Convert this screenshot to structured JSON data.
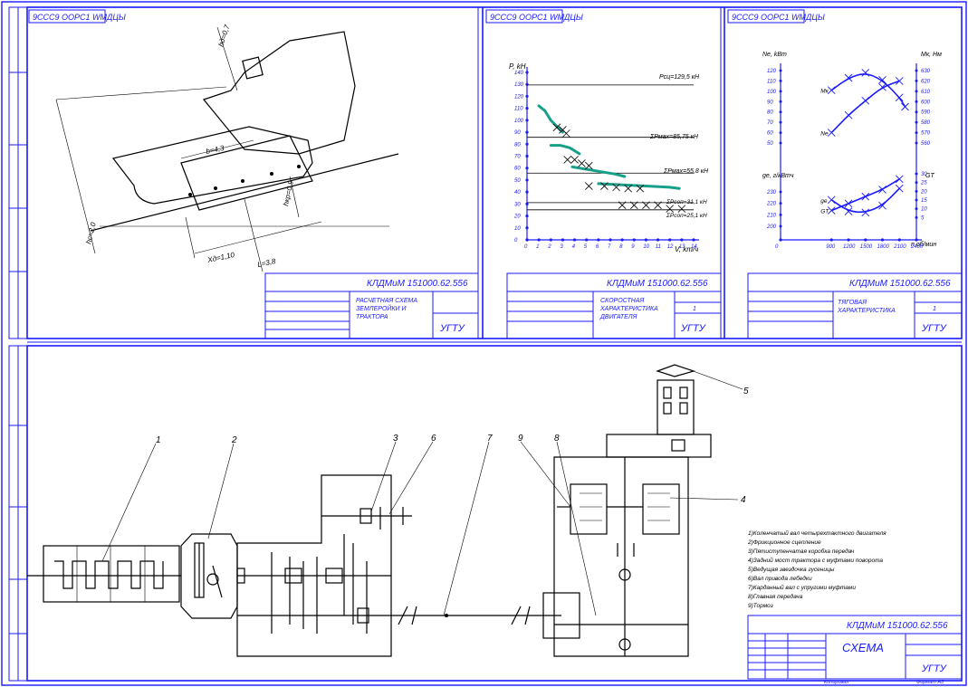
{
  "colors": {
    "frame": "#1a1aff",
    "ink": "#000000",
    "curve": "#16a08a",
    "paper": "#ffffff"
  },
  "stamp_code": "9ССС9 ООРС1 WМДЦЫ",
  "sheets": {
    "top_left": {
      "doc_code": "КЛДМиМ 151000.62.556",
      "title_l1": "РАСЧЕТНАЯ СХЕМА",
      "title_l2": "ЗЕМЛЕРОЙКИ И",
      "title_l3": "ТРАКТОРА",
      "org": "УГТУ",
      "labels": {
        "hc": "hc=2,0",
        "b": "b=4,3",
        "hkp": "hкр=0,9",
        "hd": "hд=0,7",
        "xd": "Xд=1,10",
        "l": "L=3,8"
      }
    },
    "top_mid": {
      "doc_code": "КЛДМиМ 151000.62.556",
      "title_l1": "СКОРОСТНАЯ",
      "title_l2": "ХАРАКТЕРИСТИКА",
      "title_l3": "ДВИГАТЕЛЯ",
      "org": "УГТУ",
      "sheet_no": "1",
      "y_axis_label": "P, kH",
      "x_axis_label": "V, km/ч",
      "lines": [
        "Pсц=129,5 кН",
        "ΣPмах=85,75 кН",
        "ΣPмах=55,8 кН",
        "ΣPсоп=31,1 кН",
        "ΣPсоп=25,1 кН"
      ]
    },
    "top_right": {
      "doc_code": "КЛДМиМ 151000.62.556",
      "title_l1": "ТЯГОВАЯ",
      "title_l2": "ХАРАКТЕРИСТИКА",
      "org": "УГТУ",
      "sheet_no": "1",
      "left_axis_top": "Ne, kBm",
      "right_axis_top": "Mк, Нм",
      "left_axis_bottom": "ge, г/кВтч",
      "right_axis_bottom": "GT",
      "x_axis_label": "n об/мин",
      "curve_tags": [
        "Mк",
        "Ne",
        "ge",
        "GT"
      ]
    },
    "bottom": {
      "doc_code": "КЛДМиМ 151000.62.556",
      "title": "СХЕМА",
      "org": "УГТУ",
      "footer_left": "Копировал",
      "footer_right": "Формат А3",
      "numbers": [
        "1",
        "2",
        "3",
        "4",
        "5",
        "6",
        "7",
        "8",
        "9"
      ],
      "legend": [
        "1)Коленчатый вал четырехтактного двигателя",
        "2)Фрикционное сцепление",
        "3)Пятиступенчатая коробка передач",
        "4)Задний мост трактора с муфтами поворота",
        "5)Ведущая звездочка гусеницы",
        "6)Вал привода лебедки",
        "7)Карданный вал с упругими муфтами",
        "8)Главная передача",
        "9)Тормоз"
      ]
    }
  },
  "chart_data": [
    {
      "type": "line",
      "title": "СКОРОСТНАЯ ХАРАКТЕРИСТИКА ДВИГАТЕЛЯ",
      "xlabel": "V, km/ч",
      "ylabel": "P, kH",
      "x_ticks": [
        0,
        1,
        2,
        3,
        4,
        5,
        6,
        7,
        8,
        9,
        10,
        11,
        12,
        13,
        14
      ],
      "y_ticks": [
        0,
        10,
        20,
        30,
        40,
        50,
        60,
        70,
        80,
        90,
        100,
        110,
        120,
        130,
        140
      ],
      "xlim": [
        0,
        14
      ],
      "ylim": [
        0,
        140
      ],
      "hlines": [
        129.5,
        85.75,
        55.8,
        31.1,
        25.1
      ],
      "series": [
        {
          "x": [
            1.0,
            1.5,
            2.0,
            2.5,
            3.0
          ],
          "y": [
            112,
            108,
            100,
            95,
            90
          ]
        },
        {
          "x": [
            2.0,
            2.8,
            3.6,
            4.4
          ],
          "y": [
            79,
            79,
            77,
            72
          ]
        },
        {
          "x": [
            3.8,
            5.0,
            6.2,
            7.4,
            8.2
          ],
          "y": [
            61,
            59,
            57,
            55,
            53
          ]
        },
        {
          "x": [
            6.0,
            8.0,
            10.0,
            12.0,
            12.8
          ],
          "y": [
            47,
            46,
            45,
            44,
            43
          ]
        }
      ],
      "markers": [
        {
          "x": 2.5,
          "y": 94
        },
        {
          "x": 3.0,
          "y": 92
        },
        {
          "x": 3.3,
          "y": 89
        },
        {
          "x": 3.4,
          "y": 67
        },
        {
          "x": 4.0,
          "y": 67
        },
        {
          "x": 4.6,
          "y": 64
        },
        {
          "x": 5.2,
          "y": 62
        },
        {
          "x": 5.2,
          "y": 45
        },
        {
          "x": 6.5,
          "y": 45
        },
        {
          "x": 7.5,
          "y": 44
        },
        {
          "x": 8.5,
          "y": 43
        },
        {
          "x": 9.5,
          "y": 43
        },
        {
          "x": 8.0,
          "y": 29
        },
        {
          "x": 9.0,
          "y": 29
        },
        {
          "x": 10.0,
          "y": 29
        },
        {
          "x": 11.0,
          "y": 29
        },
        {
          "x": 12.0,
          "y": 26
        },
        {
          "x": 13.0,
          "y": 26
        }
      ]
    },
    {
      "type": "line",
      "title": "ТЯГОВАЯ ХАРАКТЕРИСТИКА",
      "xlabel": "n об/мин",
      "x_ticks": [
        0,
        900,
        1200,
        1500,
        1800,
        2100,
        2400
      ],
      "xlim": [
        0,
        2400
      ],
      "left_ticks_top": [
        50,
        60,
        70,
        80,
        90,
        100,
        110,
        120
      ],
      "right_ticks_top": [
        560,
        570,
        580,
        590,
        600,
        610,
        620,
        630
      ],
      "left_ticks_bottom": [
        200,
        210,
        220,
        230
      ],
      "right_ticks_bottom": [
        5,
        10,
        15,
        20,
        25,
        30
      ],
      "series": [
        {
          "name": "Mк",
          "x": [
            900,
            1200,
            1500,
            1800,
            2100,
            2200
          ],
          "y": [
            101,
            113,
            118,
            111,
            94,
            85
          ]
        },
        {
          "name": "Ne",
          "x": [
            900,
            1200,
            1500,
            1800,
            2100
          ],
          "y": [
            60,
            77,
            91,
            104,
            110
          ]
        },
        {
          "name": "ge",
          "x": [
            900,
            1200,
            1500,
            1800,
            2100
          ],
          "y": [
            223,
            213,
            212,
            218,
            233
          ]
        },
        {
          "name": "GT",
          "x": [
            900,
            1200,
            1500,
            1800,
            2100
          ],
          "y": [
            9,
            13,
            17,
            21,
            27
          ]
        }
      ]
    }
  ]
}
